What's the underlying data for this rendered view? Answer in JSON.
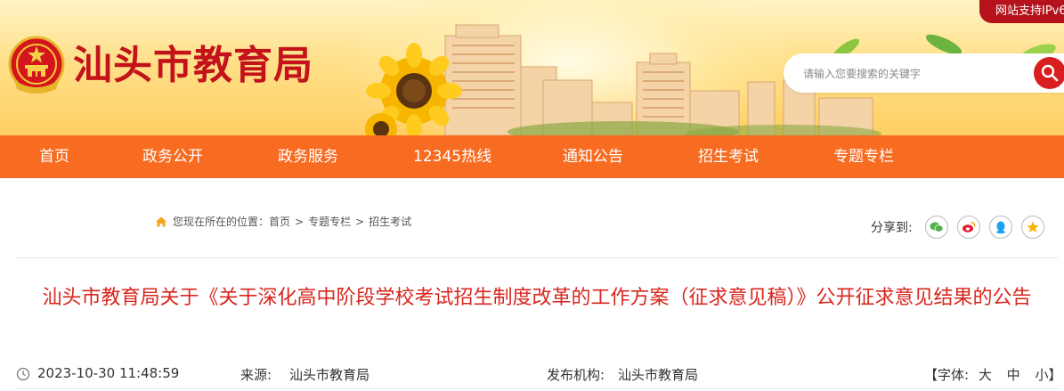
{
  "header": {
    "site_title": "汕头市教育局",
    "ipv6_badge": "网站支持IPv6",
    "search_placeholder": "请输入您要搜索的关键字"
  },
  "nav": {
    "items": [
      "首页",
      "政务公开",
      "政务服务",
      "12345热线",
      "通知公告",
      "招生考试",
      "专题专栏"
    ]
  },
  "breadcrumb": {
    "prefix": "您现在所在的位置：",
    "items": [
      "首页",
      "专题专栏",
      "招生考试"
    ],
    "separator": ">"
  },
  "share": {
    "label": "分享到:",
    "targets": [
      "wechat-icon",
      "weibo-icon",
      "qq-icon",
      "qzone-icon"
    ]
  },
  "article": {
    "title": "汕头市教育局关于《关于深化高中阶段学校考试招生制度改革的工作方案（征求意见稿）》公开征求意见结果的公告",
    "date": "2023-10-30 11:48:59",
    "source_label": "来源:",
    "source": "汕头市教育局",
    "org_label": "发布机构:",
    "org": "汕头市教育局",
    "font_size": {
      "open": "【字体:",
      "large": "大",
      "medium": "中",
      "small": "小】"
    }
  },
  "colors": {
    "nav_bg": "#f86c22",
    "title_red": "#c4121a",
    "article_title": "#d7261e",
    "search_button": "#d81e1e"
  }
}
